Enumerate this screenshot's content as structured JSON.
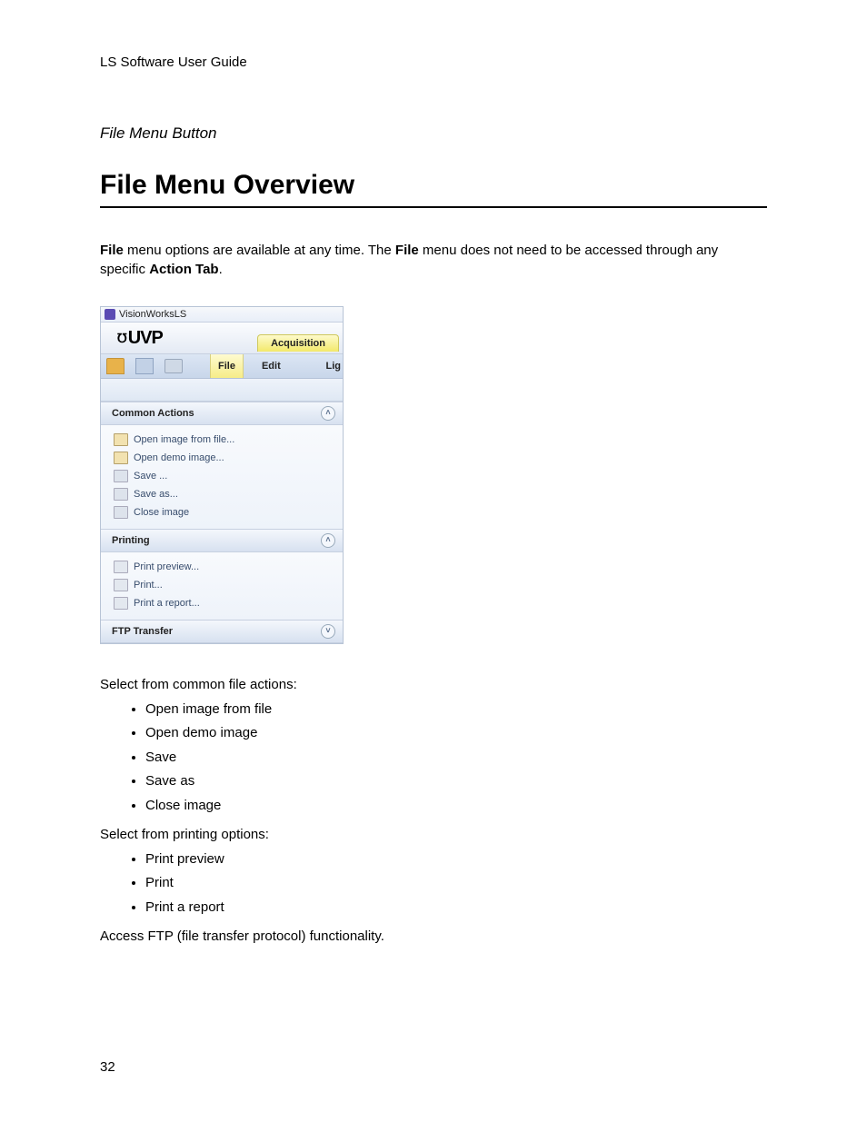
{
  "header_guide": "LS Software User Guide",
  "subtitle": "File Menu Button",
  "title": "File Menu Overview",
  "intro": {
    "pre1": "File",
    "mid1": " menu options are available at any time. The ",
    "pre2": "File",
    "mid2": " menu does not need to be accessed through any specific ",
    "pre3": "Action Tab",
    "end": "."
  },
  "shot": {
    "window_title": "VisionWorksLS",
    "logo_mark": "℧",
    "logo_text": "UVP",
    "tab_acquisition": "Acquisition",
    "toolbar": {
      "file": "File",
      "edit": "Edit",
      "lig": "Lig"
    },
    "panels": {
      "common_actions": {
        "title": "Common Actions",
        "items": {
          "open_file": "Open image from file...",
          "open_demo": "Open demo image...",
          "save": "Save ...",
          "save_as": "Save as...",
          "close": "Close image"
        }
      },
      "printing": {
        "title": "Printing",
        "items": {
          "preview": "Print preview...",
          "print": "Print...",
          "report": "Print a report..."
        }
      },
      "ftp": {
        "title": "FTP Transfer"
      }
    }
  },
  "body": {
    "select_common": "Select from common file actions:",
    "common_list": {
      "a": "Open image from file",
      "b": "Open demo image",
      "c": "Save",
      "d": "Save as",
      "e": "Close image"
    },
    "select_printing": "Select from printing options:",
    "printing_list": {
      "a": "Print preview",
      "b": "Print",
      "c": "Print a report"
    },
    "ftp_line": "Access FTP (file transfer protocol) functionality."
  },
  "page_number": "32",
  "chev_up": "˄",
  "chev_down": "˅"
}
